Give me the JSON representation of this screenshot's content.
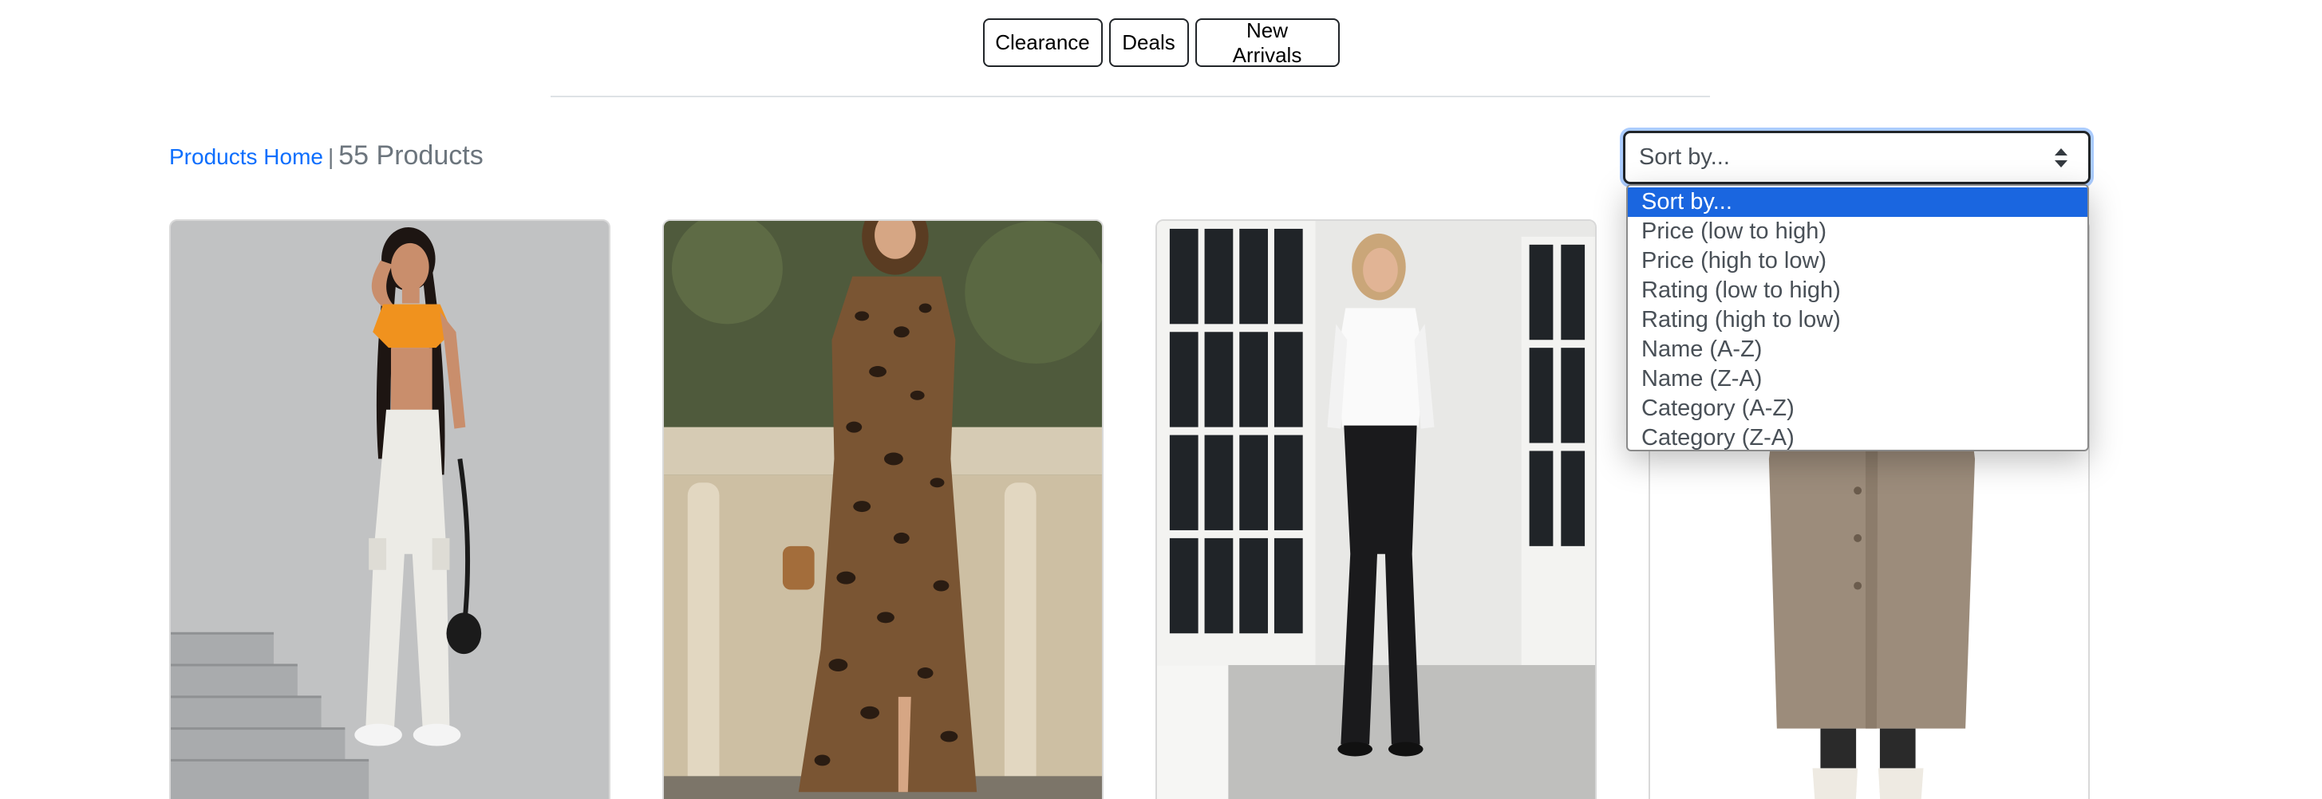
{
  "top_nav": {
    "clearance": "Clearance",
    "deals": "Deals",
    "new_arrivals": "New Arrivals"
  },
  "breadcrumb": {
    "home": "Products Home",
    "separator": "|",
    "count": "55 Products"
  },
  "sort": {
    "current": "Sort by...",
    "options": [
      "Sort by...",
      "Price (low to high)",
      "Price (high to low)",
      "Rating (low to high)",
      "Rating (high to low)",
      "Name (A-Z)",
      "Name (Z-A)",
      "Category (A-Z)",
      "Category (Z-A)"
    ],
    "highlight_color": "#1a66e0"
  },
  "colors": {
    "link": "#0d6efd",
    "muted": "#6c757d",
    "focus_ring": "#86b7fe"
  },
  "products": [
    {
      "image": "woman-orange-crop-top-white-cargo-pants"
    },
    {
      "image": "woman-leopard-print-shirt-dress"
    },
    {
      "image": "woman-white-blouse-black-flare-pants"
    },
    {
      "image": "woman-taupe-long-coat-white-boots"
    }
  ]
}
